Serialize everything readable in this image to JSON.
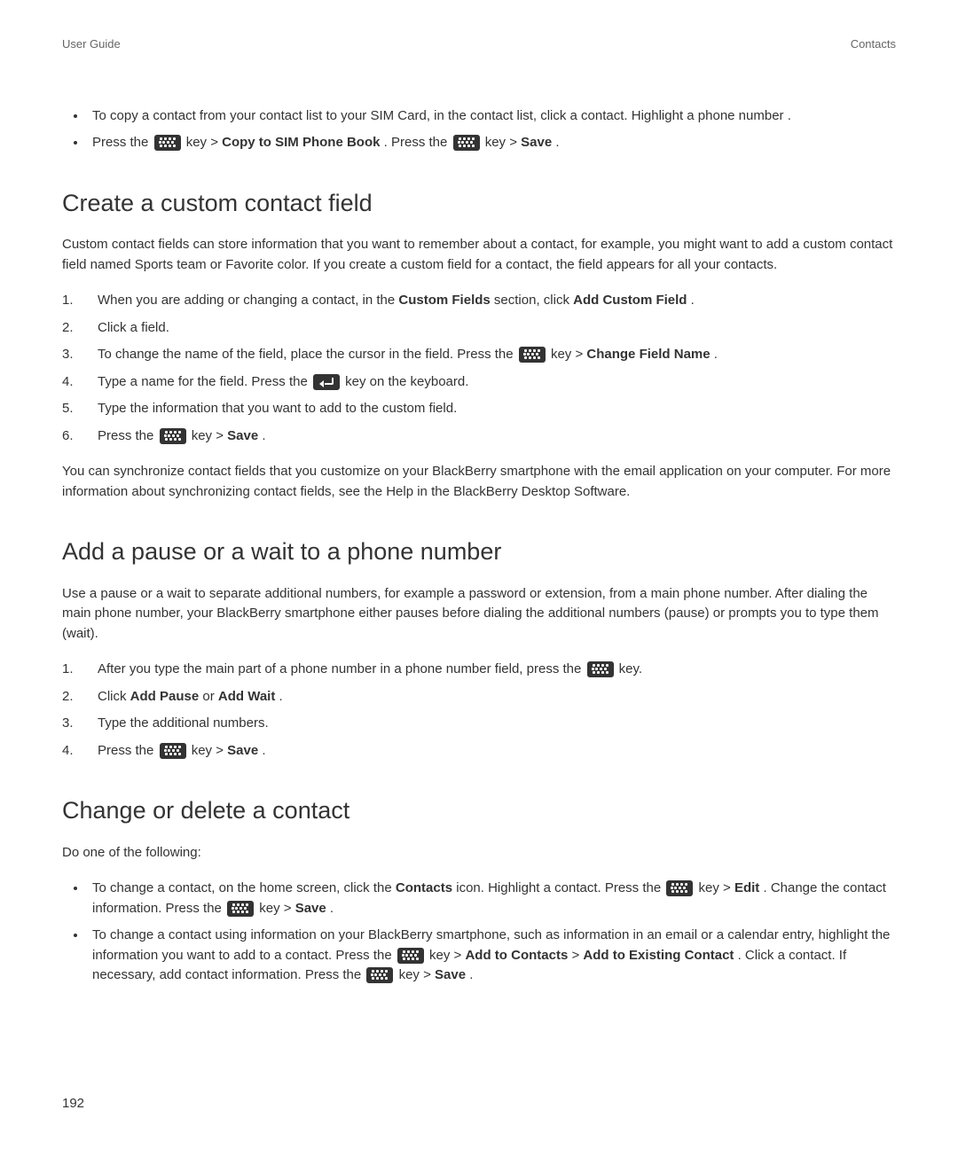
{
  "header": {
    "left": "User Guide",
    "right": "Contacts"
  },
  "intro_bullets": {
    "b1": "To copy a contact from your contact list to your SIM Card, in the contact list, click a contact. Highlight a phone number .",
    "b2_a": "Press the ",
    "b2_b": " key > ",
    "b2_bold1": "Copy to SIM Phone Book",
    "b2_c": ". Press the ",
    "b2_d": " key > ",
    "b2_bold2": "Save",
    "b2_e": "."
  },
  "s1": {
    "heading": "Create a custom contact field",
    "intro": "Custom contact fields can store information that you want to remember about a contact, for example, you might want to add a custom contact field named Sports team or Favorite color. If you create a custom field for a contact, the field appears for all your contacts.",
    "step1_a": "When you are adding or changing a contact, in the ",
    "step1_b1": "Custom Fields",
    "step1_b": " section, click ",
    "step1_b2": "Add Custom Field",
    "step1_c": ".",
    "step2": "Click a field.",
    "step3_a": "To change the name of the field, place the cursor in the field. Press the ",
    "step3_b": " key > ",
    "step3_bold": "Change Field Name",
    "step3_c": ".",
    "step4_a": "Type a name for the field. Press the ",
    "step4_b": " key on the keyboard.",
    "step5": "Type the information that you want to add to the custom field.",
    "step6_a": "Press the ",
    "step6_b": " key > ",
    "step6_bold": "Save",
    "step6_c": ".",
    "outro": "You can synchronize contact fields that you customize on your BlackBerry smartphone with the email application on your computer. For more information about synchronizing contact fields, see the Help in the BlackBerry Desktop Software."
  },
  "s2": {
    "heading": "Add a pause or a wait to a phone number",
    "intro": "Use a pause or a wait to separate additional numbers, for example a password or extension, from a main phone number. After dialing the main phone number, your BlackBerry smartphone either pauses before dialing the additional numbers (pause) or prompts you to type them (wait).",
    "step1_a": "After you type the main part of a phone number in a phone number field, press the ",
    "step1_b": " key.",
    "step2_a": "Click ",
    "step2_b1": "Add Pause",
    "step2_b": " or ",
    "step2_b2": "Add Wait",
    "step2_c": ".",
    "step3": "Type the additional numbers.",
    "step4_a": "Press the ",
    "step4_b": " key > ",
    "step4_bold": "Save",
    "step4_c": "."
  },
  "s3": {
    "heading": "Change or delete a contact",
    "intro": "Do one of the following:",
    "b1_a": "To change a contact, on the home screen, click the ",
    "b1_bold1": "Contacts",
    "b1_b": " icon. Highlight a contact. Press the ",
    "b1_c": " key > ",
    "b1_bold2": "Edit",
    "b1_d": ". Change the contact information. Press the ",
    "b1_e": " key > ",
    "b1_bold3": "Save",
    "b1_f": ".",
    "b2_a": "To change a contact using information on your BlackBerry smartphone, such as information in an email or a calendar entry, highlight the information you want to add to a contact. Press the ",
    "b2_b": " key > ",
    "b2_bold1": "Add to Contacts",
    "b2_c": " > ",
    "b2_bold2": "Add to Existing Contact",
    "b2_d": ". Click a contact. If necessary, add contact information. Press the ",
    "b2_e": " key > ",
    "b2_bold3": "Save",
    "b2_f": "."
  },
  "page_number": "192"
}
